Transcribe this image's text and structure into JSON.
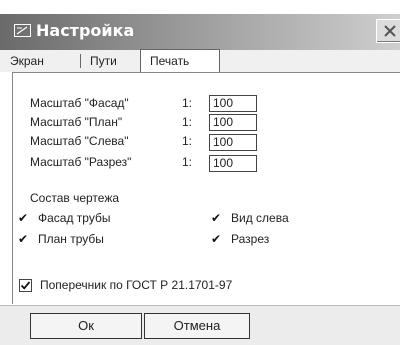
{
  "window": {
    "title": "Настройка"
  },
  "tabs": [
    {
      "label": "Экран",
      "active": false
    },
    {
      "label": "Пути",
      "active": false
    },
    {
      "label": "Печать",
      "active": true
    }
  ],
  "scales": [
    {
      "label": "Масштаб \"Фасад\"",
      "prefix": "1:",
      "value": "100"
    },
    {
      "label": "Масштаб \"План\"",
      "prefix": "1:",
      "value": "100"
    },
    {
      "label": "Масштаб \"Слева\"",
      "prefix": "1:",
      "value": "100"
    },
    {
      "label": "Масштаб \"Разрез\"",
      "prefix": "1:",
      "value": "100"
    }
  ],
  "composition": {
    "heading": "Состав чертежа",
    "items": [
      {
        "label": "Фасад трубы",
        "checked": true
      },
      {
        "label": "Вид слева",
        "checked": true
      },
      {
        "label": "План трубы",
        "checked": true
      },
      {
        "label": "Разрез",
        "checked": true
      }
    ]
  },
  "gost": {
    "label": "Поперечник по ГОСТ Р 21.1701-97",
    "checked": true
  },
  "buttons": {
    "ok": "Ок",
    "cancel": "Отмена"
  },
  "icons": {
    "app": "drawing-tool-icon",
    "close": "close-icon",
    "check": "checkmark-icon"
  }
}
